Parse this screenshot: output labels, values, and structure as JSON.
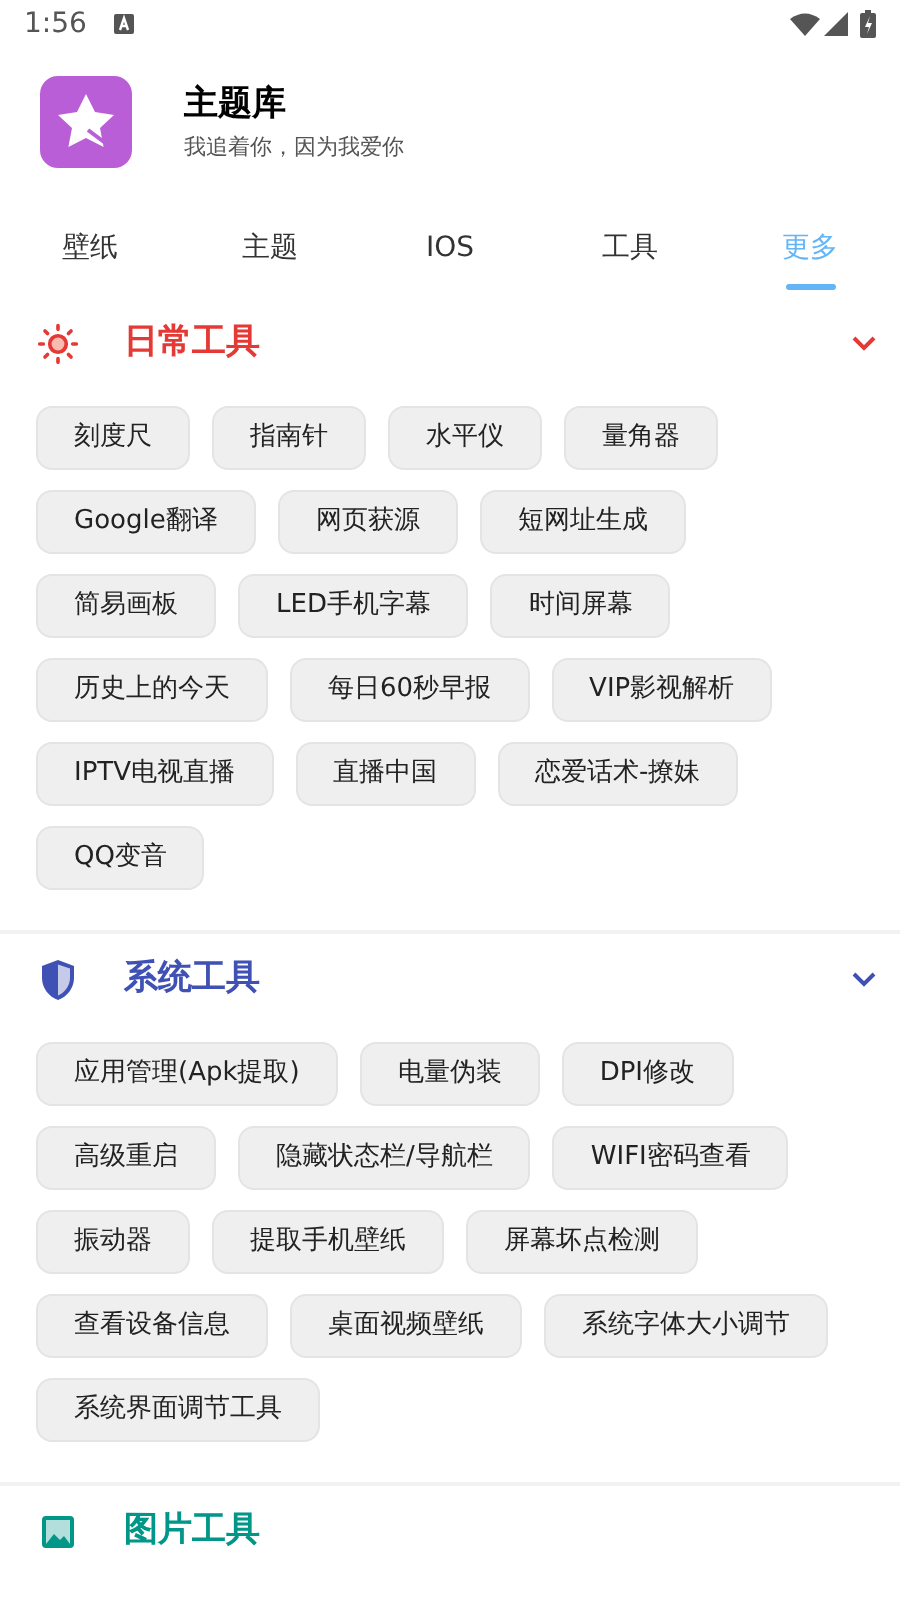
{
  "status_bar": {
    "time": "1:56"
  },
  "app": {
    "name": "主题库",
    "tagline": "我追着你，因为我爱你"
  },
  "tabs": [
    {
      "label": "壁纸",
      "selected": false
    },
    {
      "label": "主题",
      "selected": false
    },
    {
      "label": "IOS",
      "selected": false
    },
    {
      "label": "工具",
      "selected": false
    },
    {
      "label": "更多",
      "selected": true
    }
  ],
  "sections": [
    {
      "kind": "sun",
      "title": "日常工具",
      "color": "#e53935",
      "expanded": true,
      "items": [
        "刻度尺",
        "指南针",
        "水平仪",
        "量角器",
        "Google翻译",
        "网页获源",
        "短网址生成",
        "简易画板",
        "LED手机字幕",
        "时间屏幕",
        "历史上的今天",
        "每日60秒早报",
        "VIP影视解析",
        "IPTV电视直播",
        "直播中国",
        "恋爱话术-撩妹",
        "QQ变音"
      ]
    },
    {
      "kind": "shield",
      "title": "系统工具",
      "color": "#3f51b5",
      "expanded": true,
      "items": [
        "应用管理(Apk提取)",
        "电量伪装",
        "DPI修改",
        "高级重启",
        "隐藏状态栏/导航栏",
        "WIFI密码查看",
        "振动器",
        "提取手机壁纸",
        "屏幕坏点检测",
        "查看设备信息",
        "桌面视频壁纸",
        "系统字体大小调节",
        "系统界面调节工具"
      ]
    },
    {
      "kind": "image",
      "title": "图片工具",
      "color": "#009688",
      "expanded": false
    }
  ]
}
